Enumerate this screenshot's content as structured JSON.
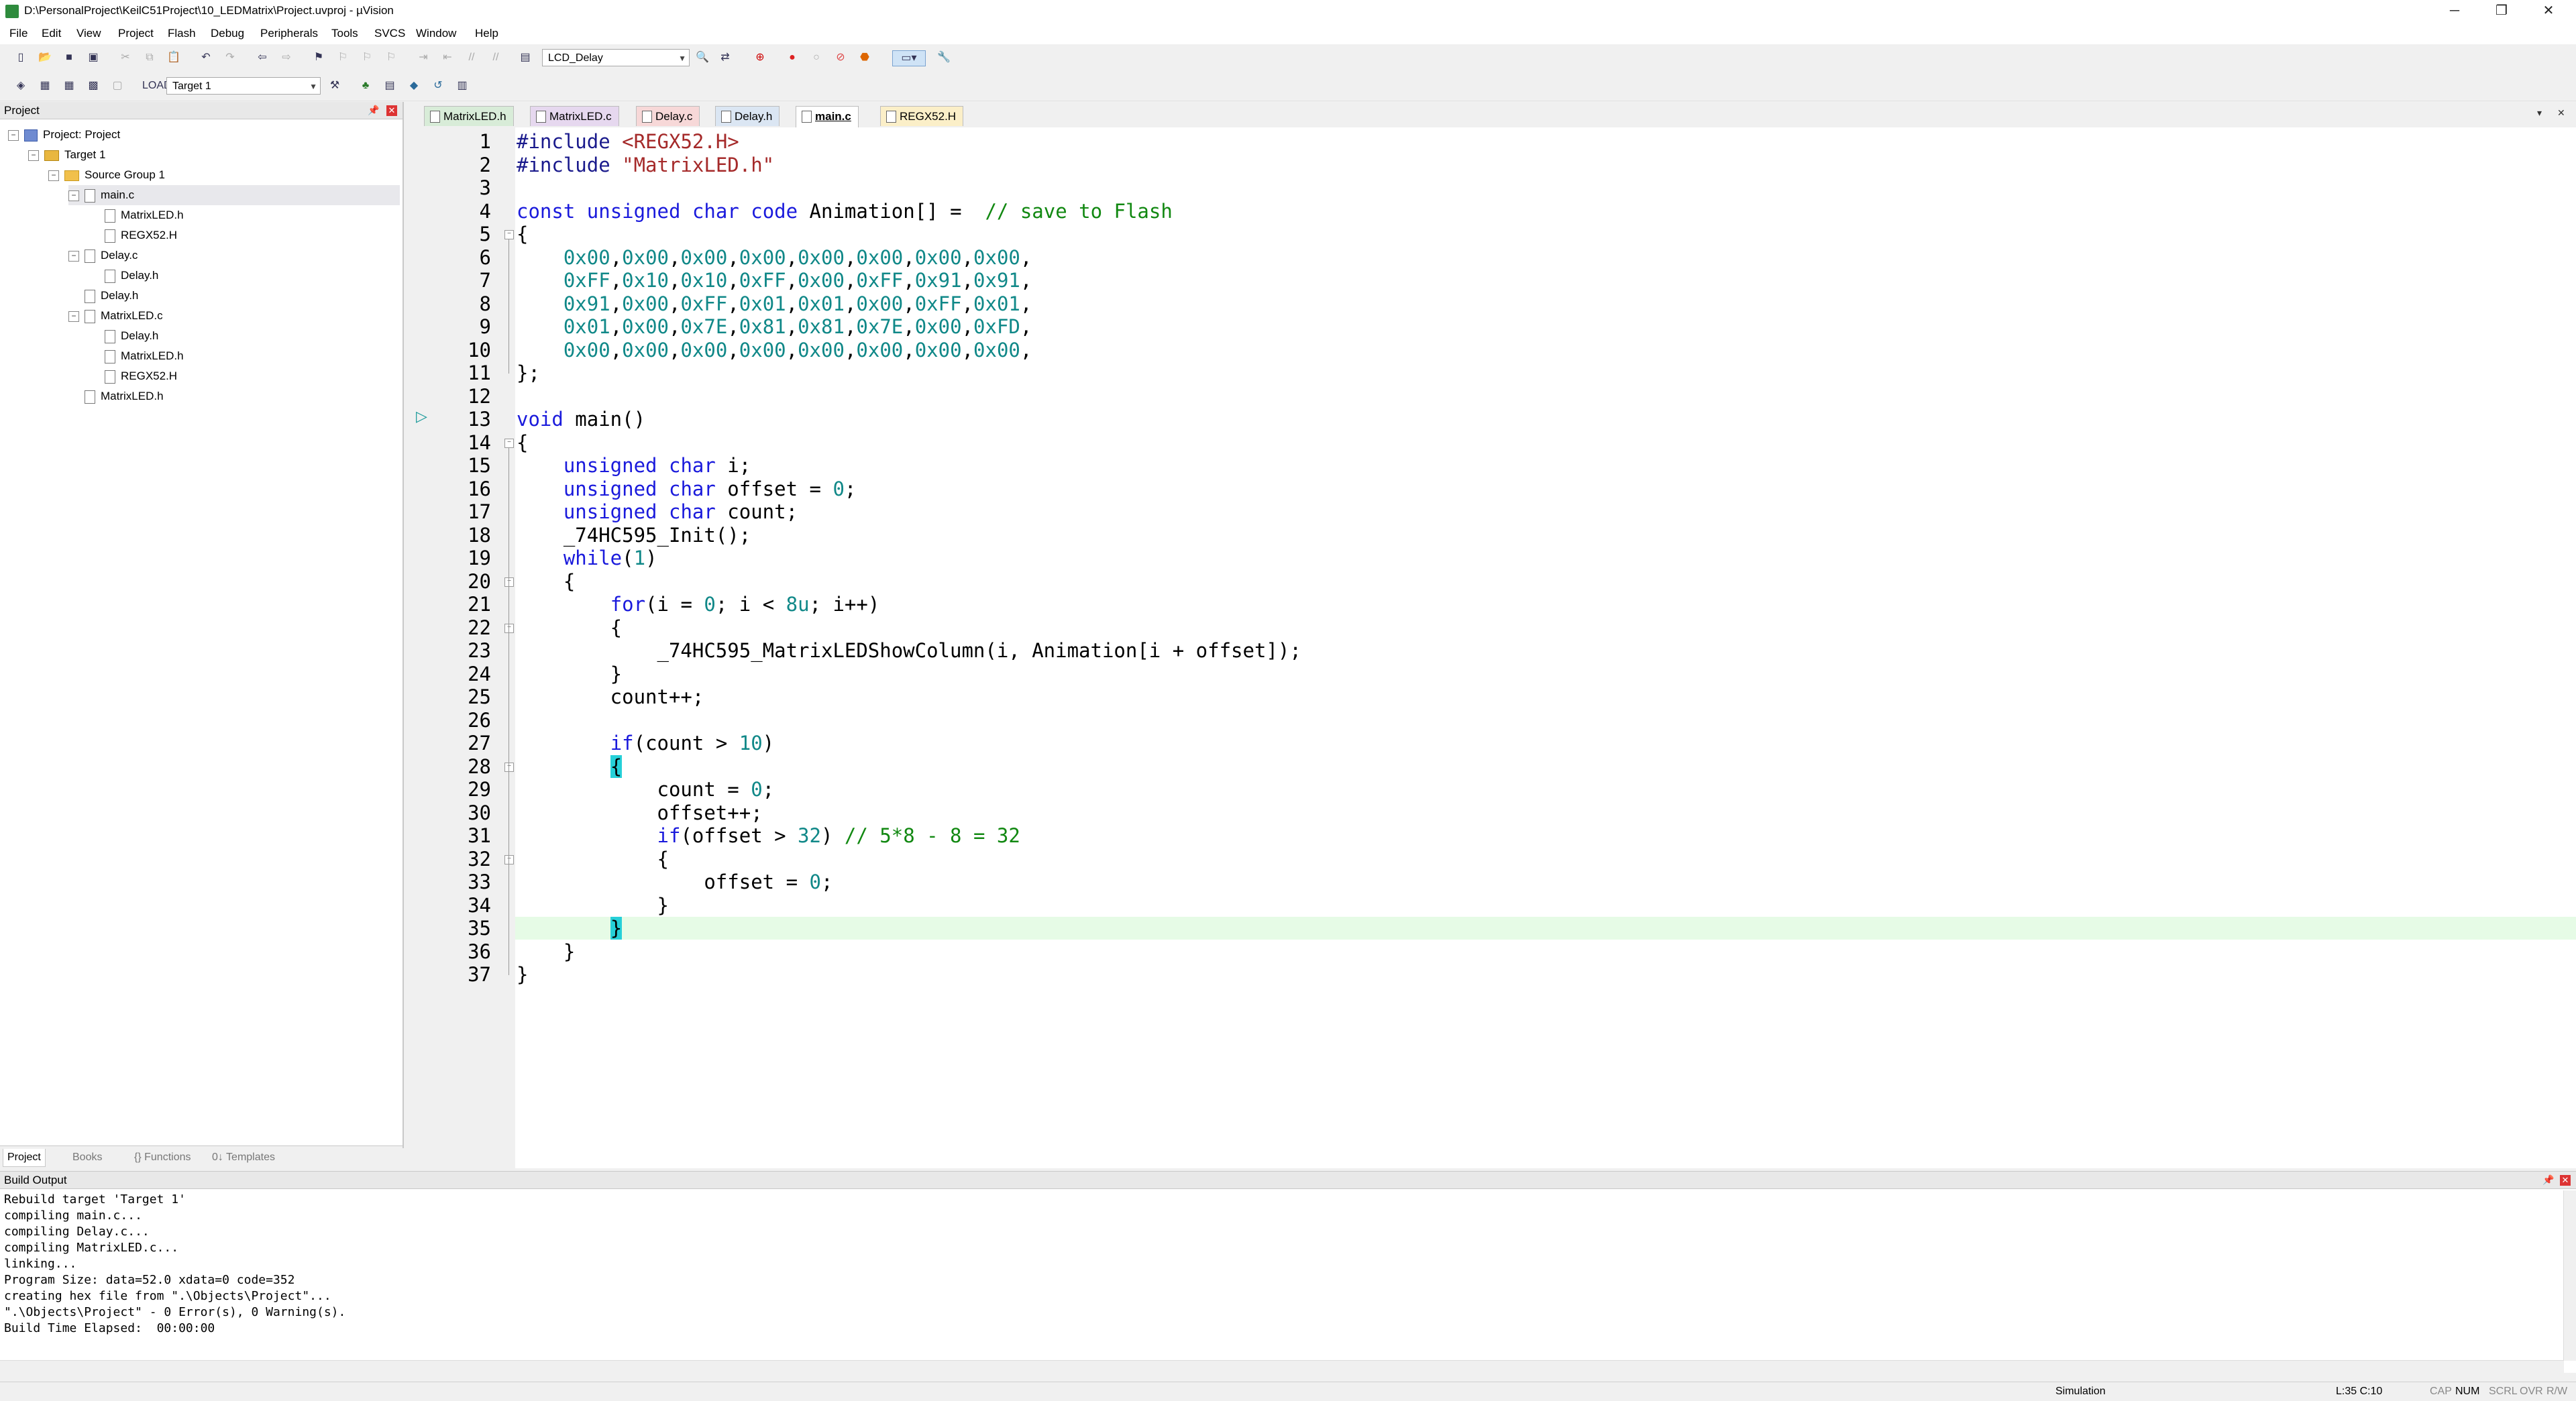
{
  "window": {
    "title": "D:\\PersonalProject\\KeilC51Project\\10_LEDMatrix\\Project.uvproj - µVision",
    "minimize": "─",
    "restore": "❐",
    "close": "✕"
  },
  "menu": [
    "File",
    "Edit",
    "View",
    "Project",
    "Flash",
    "Debug",
    "Peripherals",
    "Tools",
    "SVCS",
    "Window",
    "Help"
  ],
  "toolbar1": {
    "target_combo": "LCD_Delay"
  },
  "toolbar2": {
    "target_select": "Target 1"
  },
  "project_panel": {
    "title": "Project",
    "tree": [
      {
        "label": "Project: Project",
        "level": 0,
        "icon": "project-icon",
        "expander": "−"
      },
      {
        "label": "Target 1",
        "level": 1,
        "icon": "target-icon",
        "expander": "−"
      },
      {
        "label": "Source Group 1",
        "level": 2,
        "icon": "folder-icon",
        "expander": "−"
      },
      {
        "label": "main.c",
        "level": 3,
        "icon": "file-icon",
        "expander": "−"
      },
      {
        "label": "MatrixLED.h",
        "level": 4,
        "icon": "file-icon",
        "expander": ""
      },
      {
        "label": "REGX52.H",
        "level": 4,
        "icon": "file-icon",
        "expander": ""
      },
      {
        "label": "Delay.c",
        "level": 3,
        "icon": "file-icon",
        "expander": "−"
      },
      {
        "label": "Delay.h",
        "level": 4,
        "icon": "file-icon",
        "expander": ""
      },
      {
        "label": "Delay.h",
        "level": 3,
        "icon": "file-icon",
        "expander": ""
      },
      {
        "label": "MatrixLED.c",
        "level": 3,
        "icon": "file-icon",
        "expander": "−"
      },
      {
        "label": "Delay.h",
        "level": 4,
        "icon": "file-icon",
        "expander": ""
      },
      {
        "label": "MatrixLED.h",
        "level": 4,
        "icon": "file-icon",
        "expander": ""
      },
      {
        "label": "REGX52.H",
        "level": 4,
        "icon": "file-icon",
        "expander": ""
      },
      {
        "label": "MatrixLED.h",
        "level": 3,
        "icon": "file-icon",
        "expander": ""
      }
    ],
    "tabs": [
      "Project",
      "Books",
      "{} Functions",
      "0↓ Templates"
    ]
  },
  "editor_tabs": [
    {
      "label": "MatrixLED.h",
      "color": "#d8ecd8",
      "active": false
    },
    {
      "label": "MatrixLED.c",
      "color": "#e6d8ef",
      "active": false
    },
    {
      "label": "Delay.c",
      "color": "#f7d8d8",
      "active": false
    },
    {
      "label": "Delay.h",
      "color": "#dbe6f3",
      "active": false
    },
    {
      "label": "main.c",
      "color": "#ffffff",
      "active": true
    },
    {
      "label": "REGX52.H",
      "color": "#fbefc8",
      "active": false
    }
  ],
  "editor": {
    "current_line": 35,
    "lines": [
      "#include <REGX52.H>",
      "#include \"MatrixLED.h\"",
      "",
      "const unsigned char code Animation[] =  // save to Flash",
      "{",
      "    0x00,0x00,0x00,0x00,0x00,0x00,0x00,0x00,",
      "    0xFF,0x10,0x10,0xFF,0x00,0xFF,0x91,0x91,",
      "    0x91,0x00,0xFF,0x01,0x01,0x00,0xFF,0x01,",
      "    0x01,0x00,0x7E,0x81,0x81,0x7E,0x00,0xFD,",
      "    0x00,0x00,0x00,0x00,0x00,0x00,0x00,0x00,",
      "};",
      "",
      "void main()",
      "{",
      "    unsigned char i;",
      "    unsigned char offset = 0;",
      "    unsigned char count;",
      "    _74HC595_Init();",
      "    while(1)",
      "    {",
      "        for(i = 0; i < 8u; i++)",
      "        {",
      "            _74HC595_MatrixLEDShowColumn(i, Animation[i + offset]);",
      "        }",
      "        count++;",
      "",
      "        if(count > 10)",
      "        {",
      "            count = 0;",
      "            offset++;",
      "            if(offset > 32) // 5*8 - 8 = 32",
      "            {",
      "                offset = 0;",
      "            }",
      "        }",
      "    }",
      "}"
    ]
  },
  "build_output": {
    "title": "Build Output",
    "lines": [
      "Rebuild target 'Target 1'",
      "compiling main.c...",
      "compiling Delay.c...",
      "compiling MatrixLED.c...",
      "linking...",
      "Program Size: data=52.0 xdata=0 code=352",
      "creating hex file from \".\\Objects\\Project\"...",
      "\".\\Objects\\Project\" - 0 Error(s), 0 Warning(s).",
      "Build Time Elapsed:  00:00:00"
    ]
  },
  "status_bar": {
    "mode": "Simulation",
    "position": "L:35 C:10",
    "caps": "CAP",
    "num": "NUM",
    "scrl": "SCRL",
    "ovr": "OVR",
    "rw": "R/W"
  }
}
